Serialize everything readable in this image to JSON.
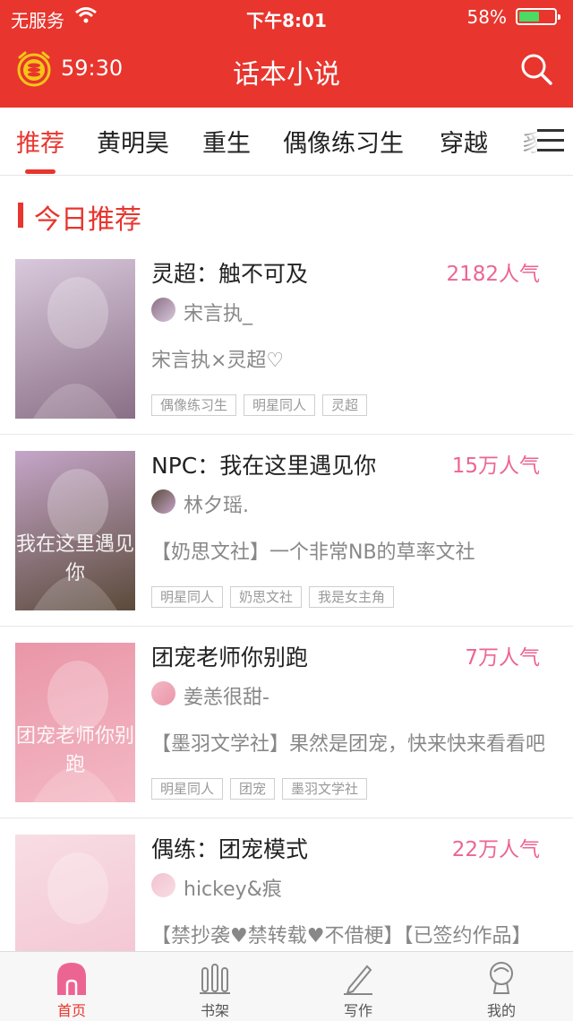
{
  "status_bar": {
    "carrier": "无服务",
    "time": "下午8:01",
    "battery": "58%",
    "battery_level": 0.58
  },
  "nav": {
    "timer": "59:30",
    "title": "话本小说"
  },
  "tabs": [
    "推荐",
    "黄明昊",
    "重生",
    "偶像练习生",
    "穿越",
    "豸"
  ],
  "section": {
    "title": "今日推荐"
  },
  "books": [
    {
      "title": "灵超：触不可及",
      "popularity": "2182人气",
      "author": "宋言执_",
      "description": "宋言执×灵超♡",
      "tags": [
        "偶像练习生",
        "明星同人",
        "灵超"
      ],
      "cover_text": "",
      "cover_colors": [
        "#8a6f86",
        "#d9c9dc"
      ]
    },
    {
      "title": "NPC：我在这里遇见你",
      "popularity": "15万人气",
      "author": "林夕瑶.",
      "description": "【奶思文社】一个非常NB的草率文社",
      "tags": [
        "明星同人",
        "奶思文社",
        "我是女主角"
      ],
      "cover_text": "我在这里遇见你",
      "cover_colors": [
        "#5b4a3a",
        "#c5a6c9"
      ]
    },
    {
      "title": "团宠老师你别跑",
      "popularity": "7万人气",
      "author": "姜恙很甜-",
      "description": "【墨羽文学社】果然是团宠，快来快来看看吧",
      "tags": [
        "明星同人",
        "团宠",
        "墨羽文学社"
      ],
      "cover_text": "团宠老师你别跑",
      "cover_colors": [
        "#f4b8c4",
        "#e996a8"
      ]
    },
    {
      "title": "偶练：团宠模式",
      "popularity": "22万人气",
      "author": "hickey&痕",
      "description": "【禁抄袭♥禁转载♥不借梗】【已签约作品】",
      "tags": [],
      "cover_text": "",
      "cover_colors": [
        "#f2c2cf",
        "#f8dde4"
      ]
    }
  ],
  "tabbar": [
    {
      "label": "首页",
      "icon": "home-icon"
    },
    {
      "label": "书架",
      "icon": "bookshelf-icon"
    },
    {
      "label": "写作",
      "icon": "pen-icon"
    },
    {
      "label": "我的",
      "icon": "profile-icon"
    }
  ]
}
